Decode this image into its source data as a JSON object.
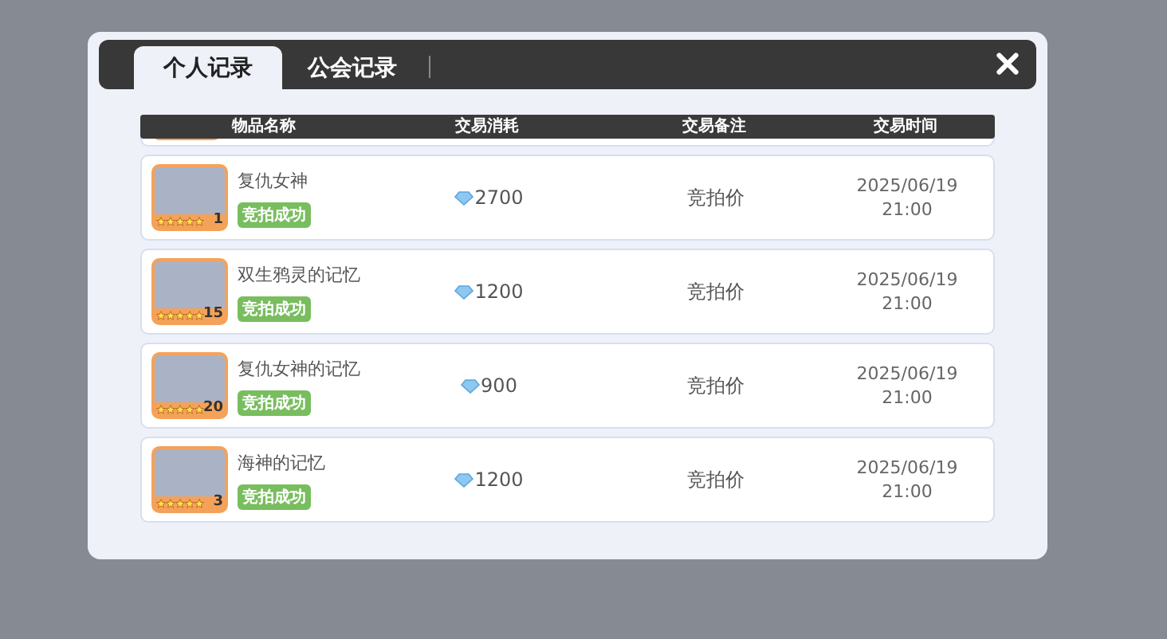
{
  "tabs": [
    {
      "label": "个人记录",
      "selected": true
    },
    {
      "label": "公会记录",
      "selected": false
    }
  ],
  "table": {
    "columns": [
      "物品名称",
      "交易消耗",
      "交易备注",
      "交易时间"
    ],
    "rows": [
      {
        "name": "复仇女神",
        "status": "竞拍成功",
        "count": "1",
        "stars": 5,
        "cost": "2700",
        "note": "竞拍价",
        "date": "2025/06/19",
        "time": "21:00"
      },
      {
        "name": "双生鸦灵的记忆",
        "status": "竞拍成功",
        "count": "15",
        "stars": 5,
        "cost": "1200",
        "note": "竞拍价",
        "date": "2025/06/19",
        "time": "21:00"
      },
      {
        "name": "复仇女神的记忆",
        "status": "竞拍成功",
        "count": "20",
        "stars": 5,
        "cost": "900",
        "note": "竞拍价",
        "date": "2025/06/19",
        "time": "21:00"
      },
      {
        "name": "海神的记忆",
        "status": "竞拍成功",
        "count": "3",
        "stars": 5,
        "cost": "1200",
        "note": "竞拍价",
        "date": "2025/06/19",
        "time": "21:00"
      }
    ]
  }
}
